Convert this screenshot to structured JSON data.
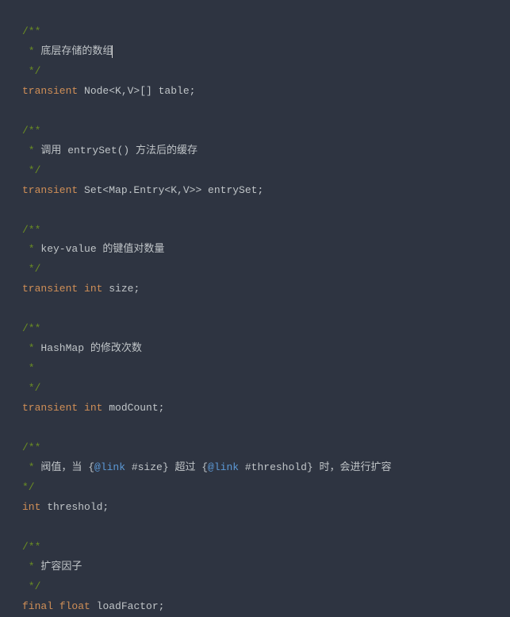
{
  "lines": [
    {
      "segments": [
        {
          "cls": "comment-doc",
          "text": "/**"
        }
      ]
    },
    {
      "segments": [
        {
          "cls": "comment-doc",
          "text": " * "
        },
        {
          "cls": "text-normal",
          "text": "底层存储的数组"
        }
      ],
      "cursor": true
    },
    {
      "segments": [
        {
          "cls": "comment-doc",
          "text": " */"
        }
      ]
    },
    {
      "segments": [
        {
          "cls": "keyword",
          "text": "transient"
        },
        {
          "cls": "text-normal",
          "text": " Node<K,V>[] table;"
        }
      ]
    },
    {
      "segments": [
        {
          "cls": "text-normal",
          "text": ""
        }
      ]
    },
    {
      "segments": [
        {
          "cls": "comment-doc",
          "text": "/**"
        }
      ]
    },
    {
      "segments": [
        {
          "cls": "comment-doc",
          "text": " * "
        },
        {
          "cls": "text-normal",
          "text": "调用 entrySet() 方法后的缓存"
        }
      ]
    },
    {
      "segments": [
        {
          "cls": "comment-doc",
          "text": " */"
        }
      ]
    },
    {
      "segments": [
        {
          "cls": "keyword",
          "text": "transient"
        },
        {
          "cls": "text-normal",
          "text": " Set<Map.Entry<K,V>> entrySet;"
        }
      ]
    },
    {
      "segments": [
        {
          "cls": "text-normal",
          "text": ""
        }
      ]
    },
    {
      "segments": [
        {
          "cls": "comment-doc",
          "text": "/**"
        }
      ]
    },
    {
      "segments": [
        {
          "cls": "comment-doc",
          "text": " * "
        },
        {
          "cls": "text-normal",
          "text": "key-value 的键值对数量"
        }
      ]
    },
    {
      "segments": [
        {
          "cls": "comment-doc",
          "text": " */"
        }
      ]
    },
    {
      "segments": [
        {
          "cls": "keyword",
          "text": "transient"
        },
        {
          "cls": "text-normal",
          "text": " "
        },
        {
          "cls": "keyword",
          "text": "int"
        },
        {
          "cls": "text-normal",
          "text": " size;"
        }
      ]
    },
    {
      "segments": [
        {
          "cls": "text-normal",
          "text": ""
        }
      ]
    },
    {
      "segments": [
        {
          "cls": "comment-doc",
          "text": "/**"
        }
      ]
    },
    {
      "segments": [
        {
          "cls": "comment-doc",
          "text": " * "
        },
        {
          "cls": "text-normal",
          "text": "HashMap 的修改次数"
        }
      ]
    },
    {
      "segments": [
        {
          "cls": "comment-doc",
          "text": " *"
        }
      ]
    },
    {
      "segments": [
        {
          "cls": "comment-doc",
          "text": " */"
        }
      ]
    },
    {
      "segments": [
        {
          "cls": "keyword",
          "text": "transient"
        },
        {
          "cls": "text-normal",
          "text": " "
        },
        {
          "cls": "keyword",
          "text": "int"
        },
        {
          "cls": "text-normal",
          "text": " modCount;"
        }
      ]
    },
    {
      "segments": [
        {
          "cls": "text-normal",
          "text": ""
        }
      ]
    },
    {
      "segments": [
        {
          "cls": "comment-doc",
          "text": "/**"
        }
      ]
    },
    {
      "segments": [
        {
          "cls": "comment-doc",
          "text": " * "
        },
        {
          "cls": "text-normal",
          "text": "阀值，当 {"
        },
        {
          "cls": "keyword-blue",
          "text": "@link"
        },
        {
          "cls": "text-normal",
          "text": " #size} 超过 {"
        },
        {
          "cls": "keyword-blue",
          "text": "@link"
        },
        {
          "cls": "text-normal",
          "text": " #threshold} 时，会进行扩容"
        }
      ]
    },
    {
      "segments": [
        {
          "cls": "comment-doc",
          "text": "*/"
        }
      ]
    },
    {
      "segments": [
        {
          "cls": "keyword",
          "text": "int"
        },
        {
          "cls": "text-normal",
          "text": " threshold;"
        }
      ]
    },
    {
      "segments": [
        {
          "cls": "text-normal",
          "text": ""
        }
      ]
    },
    {
      "segments": [
        {
          "cls": "comment-doc",
          "text": "/**"
        }
      ]
    },
    {
      "segments": [
        {
          "cls": "comment-doc",
          "text": " * "
        },
        {
          "cls": "text-normal",
          "text": "扩容因子"
        }
      ]
    },
    {
      "segments": [
        {
          "cls": "comment-doc",
          "text": " */"
        }
      ]
    },
    {
      "segments": [
        {
          "cls": "keyword",
          "text": "final"
        },
        {
          "cls": "text-normal",
          "text": " "
        },
        {
          "cls": "keyword",
          "text": "float"
        },
        {
          "cls": "text-normal",
          "text": " loadFactor;"
        }
      ]
    }
  ]
}
